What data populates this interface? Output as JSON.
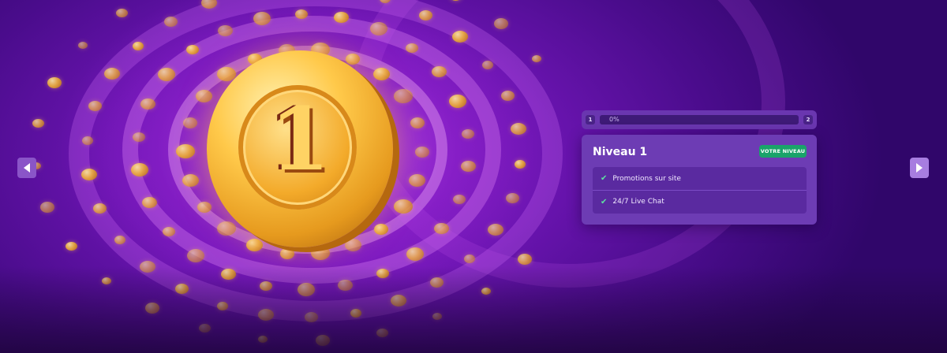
{
  "nav": {
    "prev_icon": "chevron-left-icon",
    "next_icon": "chevron-right-icon"
  },
  "hero": {
    "coin_digit": "1",
    "accent": "#8a1fc9",
    "coin_gold": "#f0b23a"
  },
  "progress": {
    "level_from": "1",
    "level_to": "2",
    "percent_text": "0%",
    "value": 0
  },
  "level_card": {
    "title": "Niveau 1",
    "badge": "VOTRE NIVEAU",
    "badge_color": "#1aa36a",
    "benefits": [
      {
        "icon": "check-icon",
        "label": "Promotions sur site"
      },
      {
        "icon": "check-icon",
        "label": "24/7 Live Chat"
      }
    ]
  }
}
